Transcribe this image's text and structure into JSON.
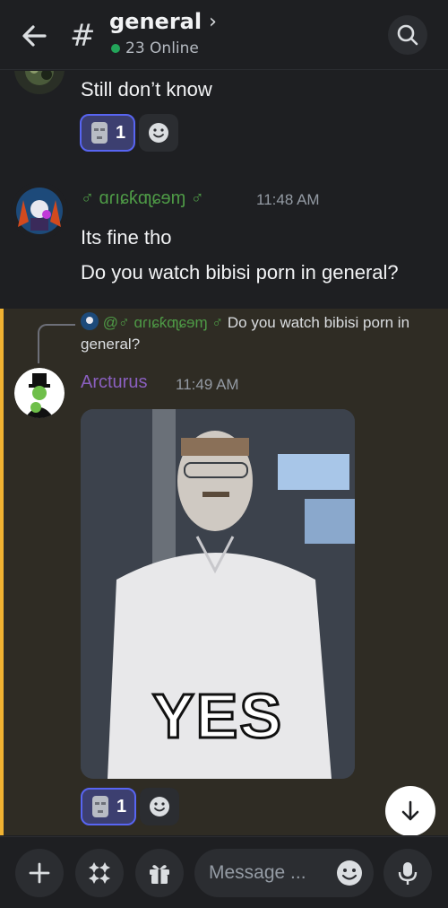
{
  "header": {
    "channel_name": "general",
    "chevron": "›",
    "hash": "#",
    "online": "23 Online"
  },
  "messages": {
    "m1": {
      "text": "Still don’t know",
      "reaction_count": "1"
    },
    "m2": {
      "author": "♂ ɑɾıɕƙɑʅɕɘɱ ♂",
      "time": "11:48 AM",
      "line1": "Its fine tho",
      "line2": "Do you watch bibisi porn in general?"
    },
    "m3": {
      "reply_mention": "@♂ ɑɾıɕƙɑʅɕɘɱ ♂",
      "reply_text": "Do you watch bibisi porn in general?",
      "author": "Arcturus",
      "time": "11:49 AM",
      "gif_caption": "YES",
      "reaction_count": "1"
    }
  },
  "input": {
    "placeholder": "Message ..."
  },
  "colors": {
    "accent": "#5865f2",
    "mention_highlight": "#f0b232",
    "online": "#23a55a",
    "author_green": "#4e9a46",
    "author_purple": "#8a5fbf"
  },
  "icons": [
    "back-arrow-icon",
    "hash-icon",
    "chevron-right-icon",
    "search-icon",
    "emoji-icon",
    "add-reaction-icon",
    "arrow-down-icon",
    "plus-icon",
    "apps-icon",
    "gift-icon",
    "microphone-icon"
  ]
}
